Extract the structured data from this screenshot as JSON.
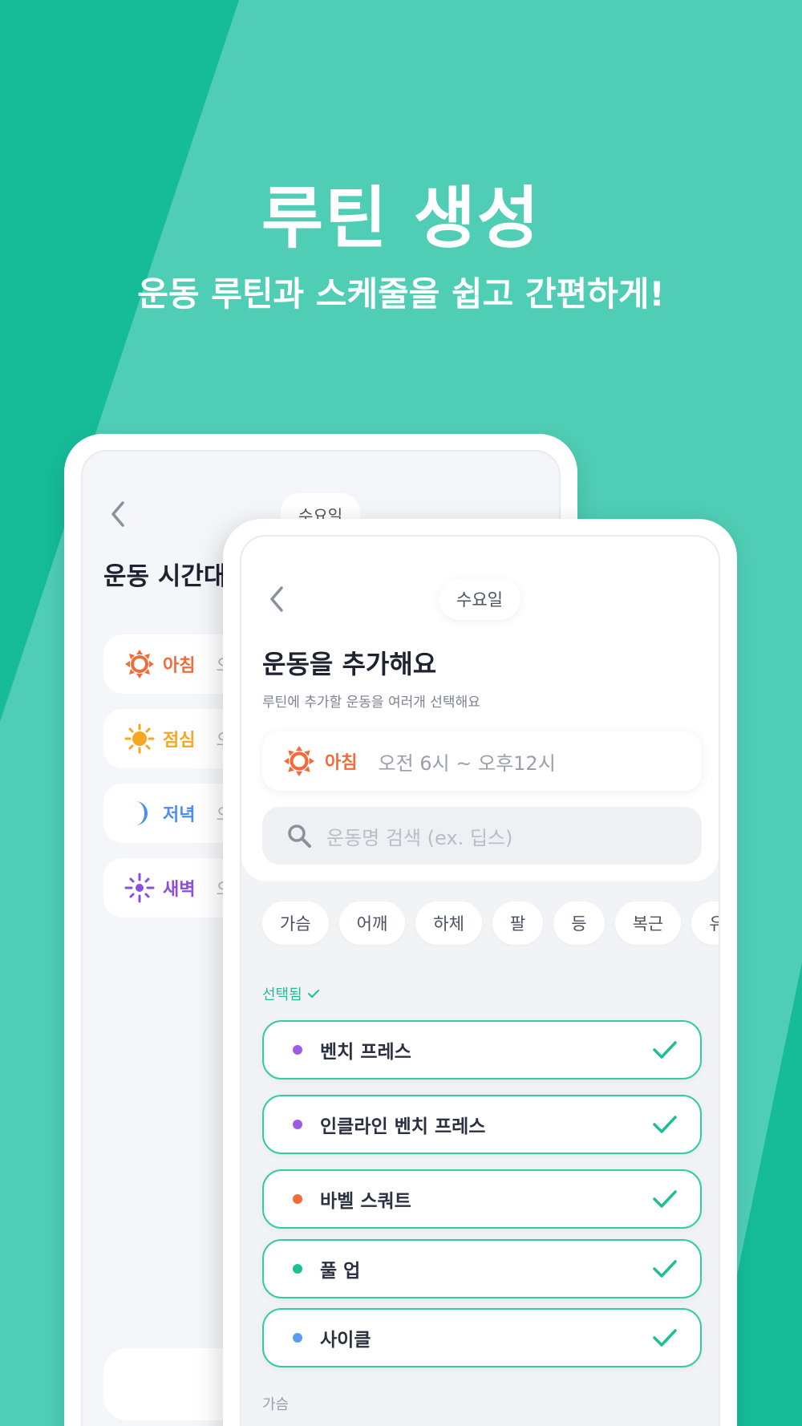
{
  "colors": {
    "accent": "#1fbf94",
    "bg_dark": "#16bb98",
    "bg_light": "#4fceb5"
  },
  "hero": {
    "title": "루틴 생성",
    "subtitle": "운동 루틴과 스케줄을 쉽고 간편하게!"
  },
  "back_screen": {
    "day": "수요일",
    "title": "운동 시간대",
    "slots": [
      {
        "label": "아침",
        "time": "오",
        "icon": "sun-icon",
        "color": "#f26b3a"
      },
      {
        "label": "점심",
        "time": "오",
        "icon": "sun-bright-icon",
        "color": "#f5a623"
      },
      {
        "label": "저녁",
        "time": "오",
        "icon": "moon-icon",
        "color": "#4a8ff0"
      },
      {
        "label": "새벽",
        "time": "오",
        "icon": "dawn-icon",
        "color": "#8a4fe0"
      }
    ]
  },
  "front_screen": {
    "day": "수요일",
    "title": "운동을 추가해요",
    "description": "루틴에 추가할 운동을 여러개 선택해요",
    "slot": {
      "label": "아침",
      "time": "오전 6시 ~ 오후12시",
      "icon": "sun-icon"
    },
    "search": {
      "placeholder": "운동명 검색 (ex. 딥스)"
    },
    "chips": [
      "가슴",
      "어깨",
      "하체",
      "팔",
      "등",
      "복근",
      "유산소"
    ],
    "selected_label": "선택됨",
    "selected": [
      {
        "name": "벤치 프레스",
        "dot": "#9b5de5"
      },
      {
        "name": "인클라인 벤치 프레스",
        "dot": "#9b5de5"
      },
      {
        "name": "바벨 스쿼트",
        "dot": "#f26b3a"
      },
      {
        "name": "풀 업",
        "dot": "#1fbf94"
      },
      {
        "name": "사이클",
        "dot": "#5b9cf0"
      }
    ],
    "section_label": "가슴"
  }
}
